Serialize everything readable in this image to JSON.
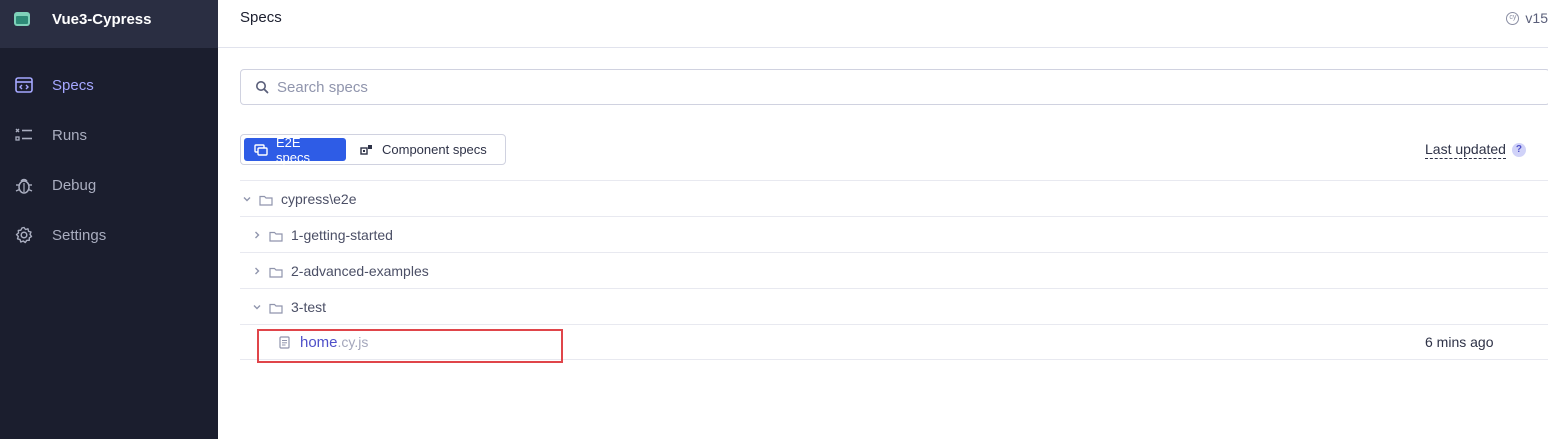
{
  "app": {
    "title": "Vue3-Cypress"
  },
  "sidebar": {
    "items": [
      {
        "label": "Specs",
        "icon": "specs-icon",
        "active": true
      },
      {
        "label": "Runs",
        "icon": "runs-icon",
        "active": false
      },
      {
        "label": "Debug",
        "icon": "debug-icon",
        "active": false
      },
      {
        "label": "Settings",
        "icon": "gear-icon",
        "active": false
      }
    ]
  },
  "header": {
    "title": "Specs",
    "version": "v15"
  },
  "search": {
    "placeholder": "Search specs",
    "value": ""
  },
  "tabs": [
    {
      "label": "E2E specs",
      "active": true
    },
    {
      "label": "Component specs",
      "active": false
    }
  ],
  "column_header": {
    "last_updated": "Last updated",
    "help": "?"
  },
  "tree": {
    "root": {
      "label": "cypress\\e2e",
      "expanded": true
    },
    "folders": [
      {
        "label": "1-getting-started",
        "expanded": false
      },
      {
        "label": "2-advanced-examples",
        "expanded": false
      },
      {
        "label": "3-test",
        "expanded": true
      }
    ],
    "spec": {
      "name": "home",
      "ext": ".cy.js",
      "updated": "6 mins ago"
    }
  },
  "colors": {
    "accent": "#2e5ce6",
    "sidebar_bg": "#1b1e2e",
    "active_nav": "#a5a7ff",
    "highlight": "#e0454a"
  }
}
